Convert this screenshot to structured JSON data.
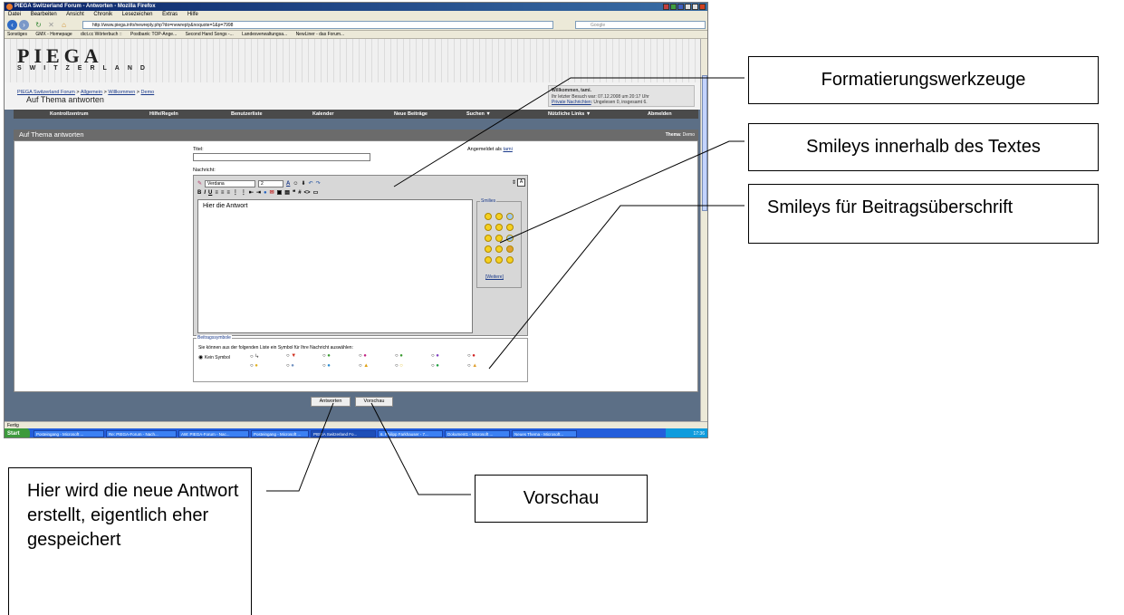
{
  "browser": {
    "window_title": "PIEGA Switzerland Forum - Antworten - Mozilla Firefox",
    "menu": [
      "Datei",
      "Bearbeiten",
      "Ansicht",
      "Chronik",
      "Lesezeichen",
      "Extras",
      "Hilfe"
    ],
    "url": "http://www.piega.info/newreply.php?do=newreply&noquote=1&p=7998",
    "search_placeholder": "Google",
    "bookmarks": [
      "Sonstiges",
      "GMX - Homepage",
      "dict.cc Wörterbuch ::",
      "Postbank: TOP-Ange...",
      "Second Hand Songs -...",
      "Landesverwaltungsa...",
      "NewLiner - das Forum..."
    ],
    "status": "Fertig"
  },
  "forum": {
    "logo": "PIEGA",
    "logo_sub": "SWITZERLAND",
    "breadcrumb": [
      "PIEGA Switzerland Forum",
      "Allgemein",
      "Willkommen",
      "Demo"
    ],
    "breadcrumb_sep": ">",
    "page_title": "Auf Thema antworten",
    "welcome_title": "Willkommen, tami.",
    "welcome_last_visit": "Ihr letzter Besuch war: 07.12.2008 um 20:17 Uhr",
    "welcome_pm_link": "Private Nachrichten",
    "welcome_pm_text": ": Ungelesen 0, insgesamt 6.",
    "nav": [
      "Kontrollzentrum",
      "Hilfe/Regeln",
      "Benutzerliste",
      "Kalender",
      "Neue Beiträge",
      "Suchen ▼",
      "Nützliche Links ▼",
      "Abmelden"
    ],
    "panel_title": "Auf Thema antworten",
    "thread_label": "Thema",
    "thread_name": ": Demo",
    "title_label": "Titel:",
    "logged_in_label": "Angemeldet als",
    "logged_in_user": "tami",
    "message_label": "Nachricht:",
    "font_name": "Verdana",
    "font_size": "2",
    "message_text": "Hier die Antwort",
    "smilies_legend": "Smilies",
    "more_smilies": "[Weitere]",
    "post_icons_legend": "Beitragssymbole",
    "post_icons_desc": "Sie können aus der folgenden Liste ein Symbol für Ihre Nachricht auswählen:",
    "no_icon_label": "Kein Symbol",
    "submit_button": "Antworten",
    "preview_button": "Vorschau"
  },
  "taskbar": {
    "start": "Start",
    "items": [
      "Posteingang - Microsoft ...",
      "Re: PIEGA-Forum - Nach...",
      "AW: PIEGA-Forum - Nac...",
      "Posteingang - Microsoft ...",
      "PIEGA Switzerland Fo...",
      "6. Philipp Farkhauser - 7...",
      "Dokument1 - Microsoft ...",
      "Neues Thema - Microsoft..."
    ],
    "clock": "17:36"
  },
  "callouts": {
    "formatting": "Formatierungswerkzeuge",
    "smileys_text": "Smileys innerhalb des Textes",
    "smileys_title": "Smileys für Beitragsüberschrift",
    "submit": "Hier wird die neue Antwort erstellt, eigentlich eher gespeichert",
    "preview": "Vorschau"
  },
  "colors": {
    "forum_nav": "#4a4a4a",
    "panel_head": "#6b6b6b",
    "link": "#1a3a8a",
    "page_bg": "#5c6f86"
  }
}
